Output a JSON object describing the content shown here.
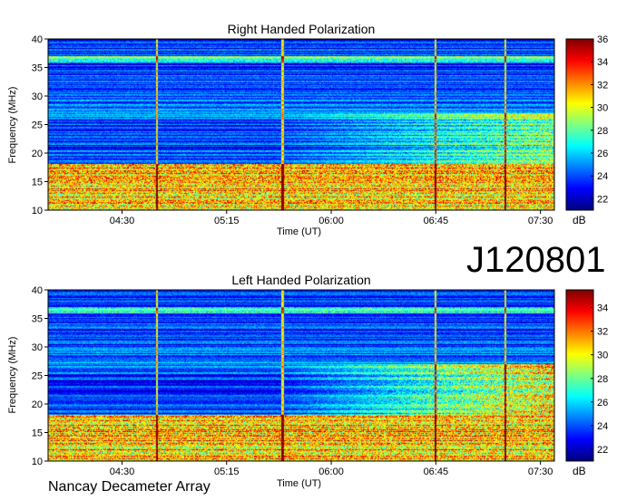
{
  "station": "J120801",
  "footer": "Nancay Decameter Array",
  "colors": {
    "low": "#00008f",
    "mid": "#00e5ff",
    "high": "#ffd000",
    "max": "#8b0000"
  },
  "chart_data": [
    {
      "type": "heatmap",
      "title": "Right Handed Polarization",
      "xlabel": "Time (UT)",
      "ylabel": "Frequency (MHz)",
      "x_ticks": [
        "04:30",
        "05:15",
        "06:00",
        "06:45",
        "07:30"
      ],
      "x_tick_values_hours": [
        4.5,
        5.25,
        6.0,
        6.75,
        7.5
      ],
      "xlim_hours": [
        3.97,
        7.6
      ],
      "ylim": [
        10,
        40
      ],
      "y_ticks": [
        10,
        15,
        20,
        25,
        30,
        35,
        40
      ],
      "colorbar": {
        "label": "dB",
        "range": [
          21,
          36
        ],
        "ticks": [
          22,
          24,
          26,
          28,
          30,
          32,
          34,
          36
        ]
      },
      "strong_bands_mhz": [
        [
          10,
          18
        ],
        [
          36,
          37
        ]
      ],
      "vertical_spikes_hours": [
        4.75,
        5.65,
        6.75,
        7.25
      ]
    },
    {
      "type": "heatmap",
      "title": "Left Handed Polarization",
      "xlabel": "Time (UT)",
      "ylabel": "Frequency (MHz)",
      "x_ticks": [
        "04:30",
        "05:15",
        "06:00",
        "06:45",
        "07:30"
      ],
      "x_tick_values_hours": [
        4.5,
        5.25,
        6.0,
        6.75,
        7.5
      ],
      "xlim_hours": [
        3.97,
        7.6
      ],
      "ylim": [
        10,
        40
      ],
      "y_ticks": [
        10,
        15,
        20,
        25,
        30,
        35,
        40
      ],
      "colorbar": {
        "label": "dB",
        "range": [
          21,
          35.5
        ],
        "ticks": [
          22,
          24,
          26,
          28,
          30,
          32,
          34
        ]
      },
      "strong_bands_mhz": [
        [
          10,
          18
        ],
        [
          36,
          37
        ]
      ],
      "vertical_spikes_hours": [
        4.75,
        5.65,
        6.75,
        7.25
      ]
    }
  ]
}
